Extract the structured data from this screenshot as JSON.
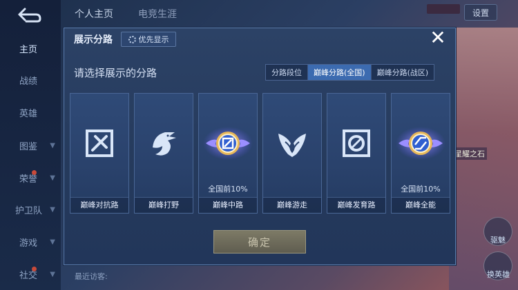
{
  "sidebar": {
    "items": [
      {
        "label": "主页",
        "active": true
      },
      {
        "label": "战绩"
      },
      {
        "label": "英雄"
      },
      {
        "label": "图鉴",
        "chevron": "chevron-down-icon"
      },
      {
        "label": "荣誉",
        "chevron": "chevron-down-icon"
      },
      {
        "label": "护卫队",
        "chevron": "chevron-down-icon"
      },
      {
        "label": "游戏",
        "chevron": "chevron-down-icon"
      },
      {
        "label": "社交",
        "chevron": "chevron-down-icon"
      }
    ]
  },
  "header": {
    "tabs": [
      {
        "label": "个人主页"
      },
      {
        "label": "电竞生涯"
      }
    ],
    "settings_label": "设置"
  },
  "background": {
    "side_label": "星耀之石",
    "corner_label_1": "驱魅",
    "corner_label_2": "换英雄",
    "visitors_label": "最近访客:"
  },
  "modal": {
    "title": "展示分路",
    "priority_label": "优先显示",
    "prompt": "请选择展示的分路",
    "segments": [
      {
        "label": "分路段位",
        "active": false
      },
      {
        "label": "巅峰分路(全国)",
        "active": true
      },
      {
        "label": "巅峰分路(战区)",
        "active": false
      }
    ],
    "cards": [
      {
        "name": "巅峰对抗路",
        "rank": "",
        "icon": "sword-lane-icon",
        "glow": false
      },
      {
        "name": "巅峰打野",
        "rank": "",
        "icon": "dragon-jungle-icon",
        "glow": false
      },
      {
        "name": "巅峰中路",
        "rank": "全国前10%",
        "icon": "mid-lane-badge-icon",
        "glow": true
      },
      {
        "name": "巅峰游走",
        "rank": "",
        "icon": "wings-support-icon",
        "glow": false
      },
      {
        "name": "巅峰发育路",
        "rank": "",
        "icon": "target-adc-icon",
        "glow": false
      },
      {
        "name": "巅峰全能",
        "rank": "全国前10%",
        "icon": "all-round-badge-icon",
        "glow": true
      }
    ],
    "confirm_label": "确定"
  },
  "colors": {
    "accent": "#3c6bb0",
    "modal_bg": "#2c4266",
    "glow_gold": "#e7b85a",
    "glow_purple": "#8a7cff"
  }
}
